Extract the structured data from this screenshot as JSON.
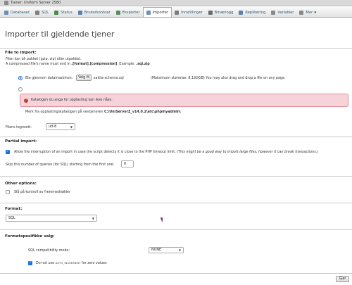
{
  "breadcrumb": "Tjener: Uniform Server 2580",
  "tabs": [
    {
      "label": "Databaser",
      "icon": "database-icon",
      "color": "#6a8fb8"
    },
    {
      "label": "SQL",
      "icon": "sql-icon",
      "color": "#7d7d7d"
    },
    {
      "label": "Status",
      "icon": "status-icon",
      "color": "#4a8a4a"
    },
    {
      "label": "Brukerkontoer",
      "icon": "users-icon",
      "color": "#5b7fb0"
    },
    {
      "label": "Eksporter",
      "icon": "export-icon",
      "color": "#5d8a5d"
    },
    {
      "label": "Importer",
      "icon": "import-icon",
      "color": "#6d8fb7"
    },
    {
      "label": "Innstillinger",
      "icon": "settings-icon",
      "color": "#7b7b7b"
    },
    {
      "label": "Binærlogg",
      "icon": "binlog-icon",
      "color": "#6a6a6a"
    },
    {
      "label": "Replikering",
      "icon": "replication-icon",
      "color": "#5c7fae"
    },
    {
      "label": "Variabler",
      "icon": "variables-icon",
      "color": "#888888"
    },
    {
      "label": "Mer",
      "icon": "more-icon",
      "color": "#888888"
    }
  ],
  "page_title": "Importer til gjeldende tjener",
  "file_import": {
    "title": "File to import:",
    "desc1": "Filen kan bli pakket (gzip, zip) eller utpakket.",
    "desc2_prefix": "A compressed file's name must end in ",
    "desc2_bold": ".[format].[compression]",
    "desc2_suffix": ". Example: ",
    "desc2_example": ".sql.zip",
    "browse_label": "Bla gjennom datamaskinen:",
    "choose_button": "Velg fil",
    "chosen_file": "sakila-schema.sql",
    "max_size": "(Maksimum størrelse: 8,192KiB) You may also drag and drop a file on any page.",
    "error_msg": "Katalogen du anga for opplasting kan ikke nåes.",
    "upload_dir_prefix": "Merk fra opplastingskatalogen på vevtjeneren ",
    "upload_dir_path": "C:\\UniServerZ_v14.0.2\\etc\\phpmyadmin\\",
    "charset_label": "Filens tegnsett:",
    "charset_value": "utf-8"
  },
  "partial_import": {
    "title": "Partial import:",
    "allow_interrupt_text": "Allow the interruption of an import in case the script detects it is close to the PHP timeout limit.",
    "allow_interrupt_note": "(This might be a good way to import large files, however it can break transactions.)",
    "skip_label": "Skip this number of queries (for SQL) starting from the first one:",
    "skip_value": "0"
  },
  "other_options": {
    "title": "Other options:",
    "fk_label": "Slå på kontroll av fremmednøkler"
  },
  "format": {
    "title": "Format:",
    "value": "SQL"
  },
  "format_options": {
    "title": "Formatspesifikke valg:",
    "compat_label": "SQL compatibility mode:",
    "compat_value": "NONE",
    "auto_zero_prefix": "Do not use ",
    "auto_zero_code": "AUTO_INCREMENT",
    "auto_zero_suffix": " for zero values"
  },
  "submit_button": "Gjør"
}
